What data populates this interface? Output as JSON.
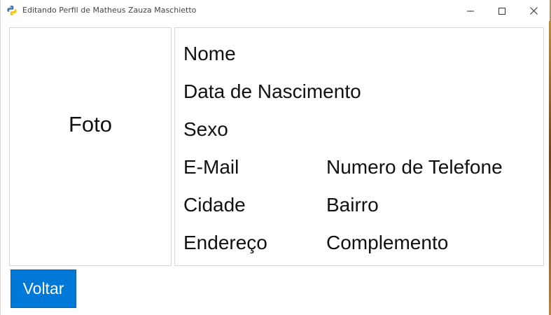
{
  "window": {
    "title": "Editando Perfil de Matheus Zauza Maschietto"
  },
  "photo": {
    "label": "Foto"
  },
  "profile": {
    "nome": "Nome",
    "data_nascimento": "Data de Nascimento",
    "sexo": "Sexo",
    "email": "E-Mail",
    "telefone": "Numero de Telefone",
    "cidade": "Cidade",
    "bairro": "Bairro",
    "endereco": "Endereço",
    "complemento": "Complemento"
  },
  "actions": {
    "voltar_label": "Voltar"
  },
  "colors": {
    "accent": "#0078d7"
  },
  "icons": {
    "app": "python-icon",
    "minimize": "minimize-icon",
    "maximize": "maximize-icon",
    "close": "close-icon"
  }
}
